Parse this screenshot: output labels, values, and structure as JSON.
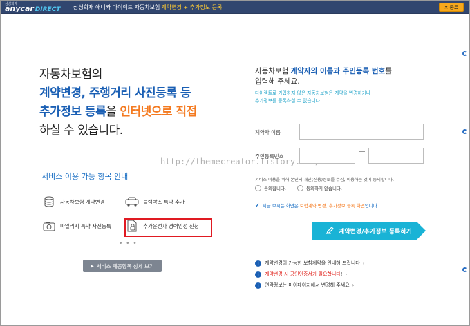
{
  "topbar": {
    "logo_small": "삼성화재",
    "logo_brand": "anycar",
    "logo_direct": "DIRECT",
    "title": "삼성화재 애니카 다이렉트 자동차보험",
    "subtitle": "계약변경 + 추가정보 등록",
    "close_label": "종료",
    "close_icon": "close-icon"
  },
  "left": {
    "headline": {
      "line1": "자동차보험의",
      "line2": "계약변경, 주행거리 사진등록 등",
      "line3_blue": "추가정보 등록",
      "line3_mid": "을 ",
      "line3_orange": "인터넷으로 직접",
      "line4": "하실 수 있습니다."
    },
    "service_title": "서비스 이용 가능 항목 안내",
    "services": [
      {
        "label": "자동차보험 계약변경",
        "icon": "database-icon"
      },
      {
        "label": "블랙박스 특약 추가",
        "icon": "car-camera-icon"
      },
      {
        "label": "마일리지 특약 사진등록",
        "icon": "camera-icon"
      },
      {
        "label": "추가운전자 경력인정 신청",
        "icon": "document-lock-icon"
      }
    ],
    "more_dots": "• • •",
    "detail_button": "서비스 제공항목 상세 보기",
    "detail_arrow": "▶"
  },
  "watermark": "http://themecreator.tistory.com/",
  "right": {
    "title_pre": "자동차보험 ",
    "title_blue": "계약자의 이름과 주민등록 번호",
    "title_post": "를",
    "title_line2": "입력해 주세요.",
    "note_line1": "다이렉트로 가입하지 않은 자동차보험은 계약을 변경하거나",
    "note_line2": "추가정보를 등록하실 수 없습니다.",
    "name_label": "계약자 이름",
    "name_value": "",
    "rrn_label": "주민등록번호",
    "rrn_front": "",
    "rrn_back": "",
    "consent_text": "서비스 이용을 위해 본인의 개인(신용)정보를 수집, 이용하는 것에 동의합니다.",
    "agree_label": "동의합니다.",
    "disagree_label": "동의하지 않습니다.",
    "check_note_pre": "지금 보시는 화면은 ",
    "check_note_orange": "보험계약 변경, 추가정보 등록 화면",
    "check_note_post": "입니다",
    "register_button": "계약변경/추가정보 등록하기",
    "register_icon": "pen-icon",
    "info_links": [
      {
        "pre": "계약변경이 가능한 보험계약을 안내해 드립니다",
        "red": "",
        "post": ""
      },
      {
        "pre": "",
        "red": "계약변경 시 공인인증서가 필요합니다",
        "post": "!"
      },
      {
        "pre": "연락정보는 마이페이지에서 변경해 주세요",
        "red": "",
        "post": ""
      }
    ]
  }
}
